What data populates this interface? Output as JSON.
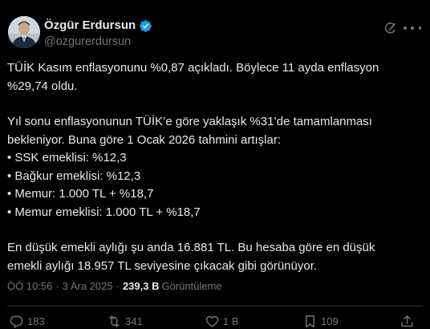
{
  "author": {
    "display_name": "Özgür Erdursun",
    "handle": "@ozgurerdursun",
    "verified_color": "#1d9bf0"
  },
  "header_icons": [
    "grok-icon",
    "more-icon"
  ],
  "body": {
    "paragraph1": [
      "TÜİK Kasım enflasyonunu %0,87 açıkladı. Böylece 11 ayda enflasyon",
      "%29,74 oldu."
    ],
    "paragraph2": [
      "Yıl sonu enflasyonunun TÜİK’e göre yaklaşık %31’de tamamlanması",
      "bekleniyor. Buna göre 1 Ocak 2026 tahmini artışlar:",
      "• SSK emeklisi: %12,3",
      "• Bağkur emeklisi: %12,3",
      "• Memur: 1.000 TL + %18,7",
      "• Memur emeklisi: 1.000 TL + %18,7"
    ],
    "paragraph3": [
      "En düşük emekli aylığı şu anda 16.881 TL. Bu hesaba göre en düşük",
      "emekli aylığı 18.957 TL seviyesine çıkacak gibi görünüyor."
    ]
  },
  "meta": {
    "time": "ÖÖ 10:56",
    "date": "3 Ara 2025",
    "views_count": "239,3 B",
    "views_label": "Görüntüleme"
  },
  "actions": {
    "replies": "183",
    "reposts": "341",
    "likes": "1 B",
    "bookmarks": "109"
  },
  "colors": {
    "background": "#000000",
    "text": "#e7e9ea",
    "secondary": "#71767b",
    "divider": "#2f3336"
  }
}
